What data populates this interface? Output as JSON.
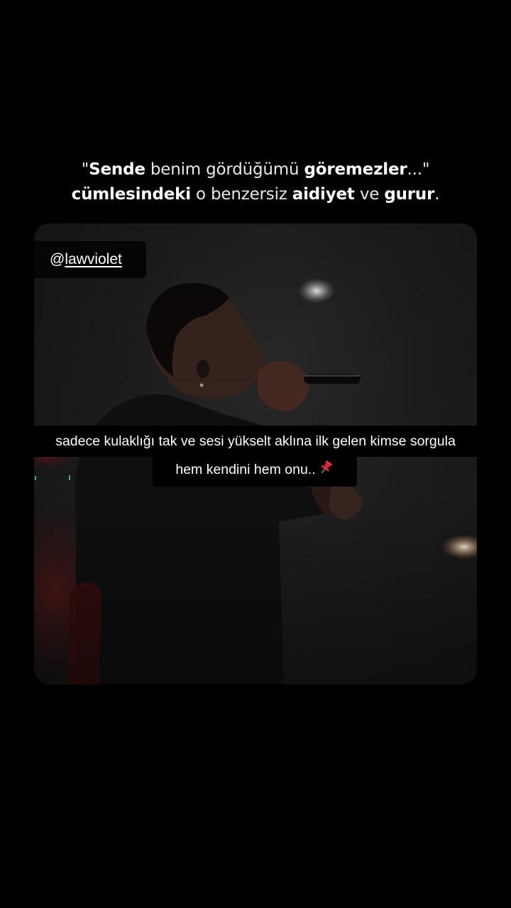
{
  "headline": {
    "line1": {
      "quote_open": "\"",
      "w1": "Sende",
      "w2": " benim gördüğümü ",
      "w3": "göremezler",
      "w4": "...\""
    },
    "line2": {
      "w1": "cümlesindeki",
      "w2": " o benzersiz ",
      "w3": "aidiyet",
      "w4": " ve ",
      "w5": "gurur",
      "w6": "."
    }
  },
  "video": {
    "handle_at": "@",
    "handle_name": "lawviolet",
    "caption_line1": "sadece kulaklığı tak ve sesi yükselt aklına ilk gelen kimse sorgula",
    "caption_line2": "hem kendini hem onu..",
    "caption_emoji_name": "pushpin-icon"
  },
  "colors": {
    "background": "#000000",
    "video_base": "#1e1e1f",
    "pin_red": "#e03040"
  }
}
